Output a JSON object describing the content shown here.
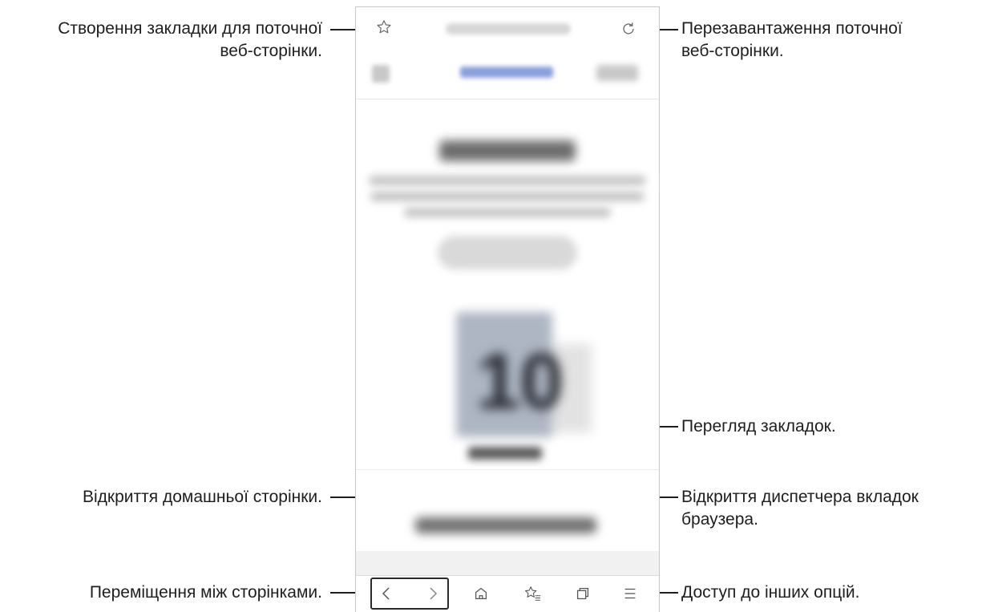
{
  "callouts": {
    "bookmark_current": "Створення закладки для поточної\nвеб-сторінки.",
    "reload": "Перезавантаження поточної\nвеб-сторінки.",
    "view_bookmarks": "Перегляд закладок.",
    "open_home": "Відкриття домашньої сторінки.",
    "tab_manager": "Відкриття диспетчера вкладок\nбраузера.",
    "navigate_pages": "Переміщення між сторінками.",
    "more_options": "Доступ до інших опцій."
  },
  "icons": {
    "bookmark_add": "star-outline-icon",
    "reload": "reload-icon",
    "back": "chevron-left-icon",
    "forward": "chevron-right-icon",
    "home": "home-icon",
    "bookmarks": "bookmarks-list-icon",
    "tabs": "tabs-icon",
    "menu": "menu-icon"
  },
  "colors": {
    "callout_line": "#1e1e1e",
    "blur_logo": "#8aa0dc"
  }
}
